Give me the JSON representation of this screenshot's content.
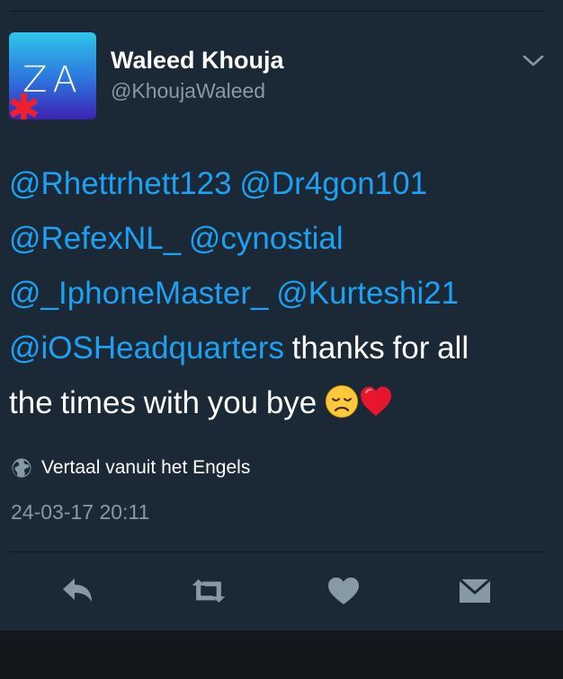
{
  "author": {
    "display_name": "Waleed Khouja",
    "handle": "@KhoujaWaleed",
    "avatar_letters": "ZA"
  },
  "tweet": {
    "lines": [
      [
        {
          "text": "@Rhettrhett123",
          "type": "mention"
        },
        {
          "text": " ",
          "type": "text"
        },
        {
          "text": "@Dr4gon101",
          "type": "mention"
        }
      ],
      [
        {
          "text": "@RefexNL_",
          "type": "mention"
        },
        {
          "text": " ",
          "type": "text"
        },
        {
          "text": "@cynostial",
          "type": "mention"
        }
      ],
      [
        {
          "text": "@_IphoneMaster_",
          "type": "mention"
        },
        {
          "text": " ",
          "type": "text"
        },
        {
          "text": "@Kurteshi21",
          "type": "mention"
        }
      ],
      [
        {
          "text": "@iOSHeadquarters",
          "type": "mention"
        },
        {
          "text": " thanks for all",
          "type": "text"
        }
      ],
      [
        {
          "text": "the times with you bye ",
          "type": "text"
        },
        {
          "text": "disappointed-face-emoji",
          "type": "emoji"
        },
        {
          "text": "red-heart-emoji",
          "type": "emoji"
        }
      ]
    ]
  },
  "translate": {
    "label": "Vertaal vanuit het Engels",
    "icon": "globe-icon"
  },
  "timestamp": "24-03-17 20:11",
  "actions": [
    {
      "name": "reply-button",
      "icon": "reply-icon"
    },
    {
      "name": "retweet-button",
      "icon": "retweet-icon"
    },
    {
      "name": "like-button",
      "icon": "heart-icon"
    },
    {
      "name": "direct-message-button",
      "icon": "envelope-icon"
    }
  ],
  "colors": {
    "background": "#1b2836",
    "mention": "#1da1f2",
    "secondary_text": "#8899a6",
    "icon": "#8899a6",
    "bottom_bar": "#14171c"
  }
}
